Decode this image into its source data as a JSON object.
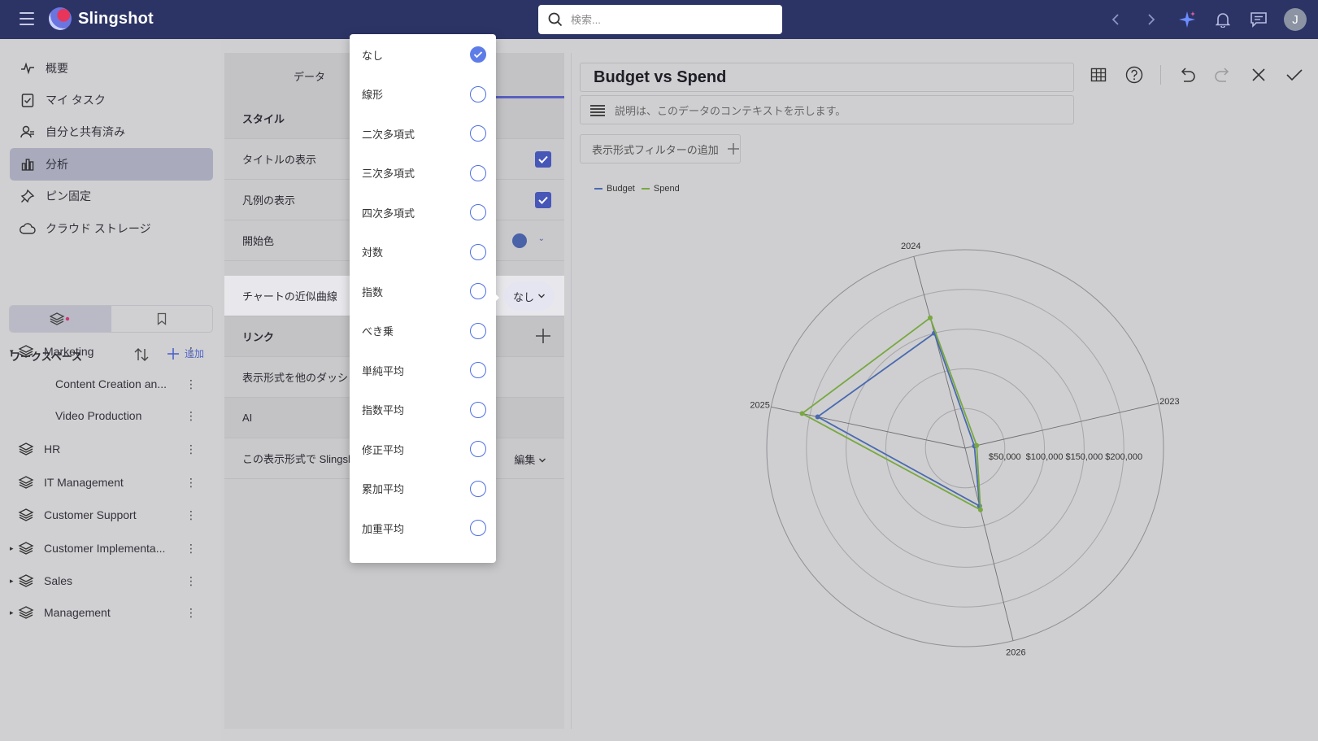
{
  "app": {
    "name": "Slingshot",
    "avatar_letter": "J"
  },
  "search": {
    "placeholder": "検索..."
  },
  "nav": [
    {
      "label": "概要",
      "icon": "activity-icon"
    },
    {
      "label": "マイ タスク",
      "icon": "task-icon"
    },
    {
      "label": "自分と共有済み",
      "icon": "shared-user-icon"
    },
    {
      "label": "分析",
      "icon": "bar-chart-icon",
      "active": true
    },
    {
      "label": "ピン固定",
      "icon": "pin-icon"
    },
    {
      "label": "クラウド ストレージ",
      "icon": "cloud-icon"
    }
  ],
  "workspace": {
    "title": "ワークスペース",
    "add_label": "追加",
    "items": [
      {
        "label": "Marketing",
        "expanded": true
      },
      {
        "label": "Content Creation an...",
        "child": true
      },
      {
        "label": "Video Production",
        "child": true
      },
      {
        "label": "HR"
      },
      {
        "label": "IT Management"
      },
      {
        "label": "Customer Support"
      },
      {
        "label": "Customer Implementa...",
        "collapsed": true
      },
      {
        "label": "Sales",
        "collapsed": true
      },
      {
        "label": "Management",
        "collapsed": true
      }
    ]
  },
  "settings": {
    "tab_data": "データ",
    "section_style": "スタイル",
    "show_title": "タイトルの表示",
    "show_legend": "凡例の表示",
    "start_color": "開始色",
    "start_color_value": "#4a62a8",
    "trendline": "チャートの近似曲線",
    "trendline_value": "なし",
    "section_link": "リンク",
    "share_row": "表示形式を他のダッシュ",
    "section_ai": "AI",
    "ai_row": "この表示形式で Slingsh",
    "ai_edit": "編集"
  },
  "trend_options": [
    {
      "label": "なし",
      "selected": true
    },
    {
      "label": "線形"
    },
    {
      "label": "二次多項式"
    },
    {
      "label": "三次多項式"
    },
    {
      "label": "四次多項式"
    },
    {
      "label": "対数"
    },
    {
      "label": "指数"
    },
    {
      "label": "べき乗"
    },
    {
      "label": "単純平均"
    },
    {
      "label": "指数平均"
    },
    {
      "label": "修正平均"
    },
    {
      "label": "累加平均"
    },
    {
      "label": "加重平均"
    }
  ],
  "viz": {
    "title": "Budget vs Spend",
    "description_placeholder": "説明は、このデータのコンテキストを示します。",
    "filter_label": "表示形式フィルターの追加"
  },
  "chart_data": {
    "type": "radar",
    "categories": [
      "2023",
      "2024",
      "2025",
      "2026"
    ],
    "series": [
      {
        "name": "Budget",
        "color": "#4a6ab0",
        "values": [
          12000,
          150000,
          190000,
          75000
        ]
      },
      {
        "name": "Spend",
        "color": "#78a840",
        "values": [
          15000,
          170000,
          210000,
          80000
        ]
      }
    ],
    "radial_ticks": [
      "$50,000",
      "$100,000",
      "$150,000",
      "$200,000"
    ],
    "rmax": 250000,
    "legend": "top-left"
  }
}
